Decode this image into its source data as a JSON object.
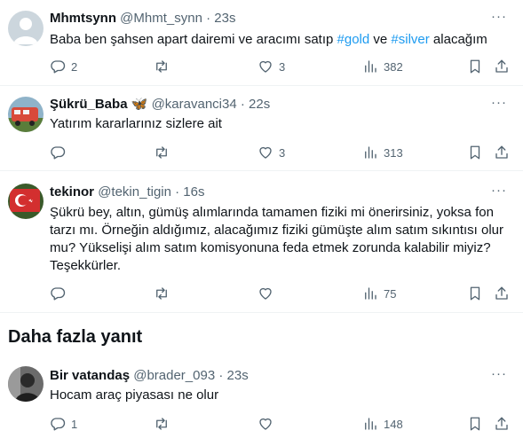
{
  "tweets": [
    {
      "name": "Mhmtsynn",
      "handle": "@Mhmt_synn",
      "time": "· 23s",
      "body_pre": "Baba ben şahsen apart dairemi ve aracımı satıp ",
      "tag1": "#gold",
      "body_mid": " ve ",
      "tag2": "#silver",
      "body_post": " alacağım",
      "replies": "2",
      "retweets": "",
      "likes": "3",
      "views": "382"
    },
    {
      "name": "Şükrü_Baba",
      "badge": "🦋",
      "handle": "@karavanci34",
      "time": "· 22s",
      "body": "Yatırım kararlarınız sizlere ait",
      "replies": "",
      "retweets": "",
      "likes": "3",
      "views": "313"
    },
    {
      "name": "tekinor",
      "handle": "@tekin_tigin",
      "time": "· 16s",
      "body": "Şükrü bey, altın, gümüş alımlarında tamamen fiziki mi önerirsiniz, yoksa fon tarzı mı. Örneğin aldığımız, alacağımız fiziki gümüşte alım satım sıkıntısı olur mu? Yükselişi alım satım komisyonuna feda etmek zorunda kalabilir miyiz? Teşekkürler.",
      "replies": "",
      "retweets": "",
      "likes": "",
      "views": "75"
    },
    {
      "name": "Bir vatandaş",
      "handle": "@brader_093",
      "time": "· 23s",
      "body": "Hocam araç piyasası ne olur",
      "replies": "1",
      "retweets": "",
      "likes": "",
      "views": "148"
    }
  ],
  "more_replies_title": "Daha fazla yanıt",
  "icons": {
    "reply": "reply-icon",
    "retweet": "retweet-icon",
    "like": "heart-icon",
    "views": "views-icon",
    "bookmark": "bookmark-icon",
    "share": "share-icon",
    "more": "more-icon"
  },
  "colors": {
    "text": "#0f1419",
    "secondary": "#536471",
    "link": "#1d9bf0",
    "border": "#eff3f4"
  }
}
